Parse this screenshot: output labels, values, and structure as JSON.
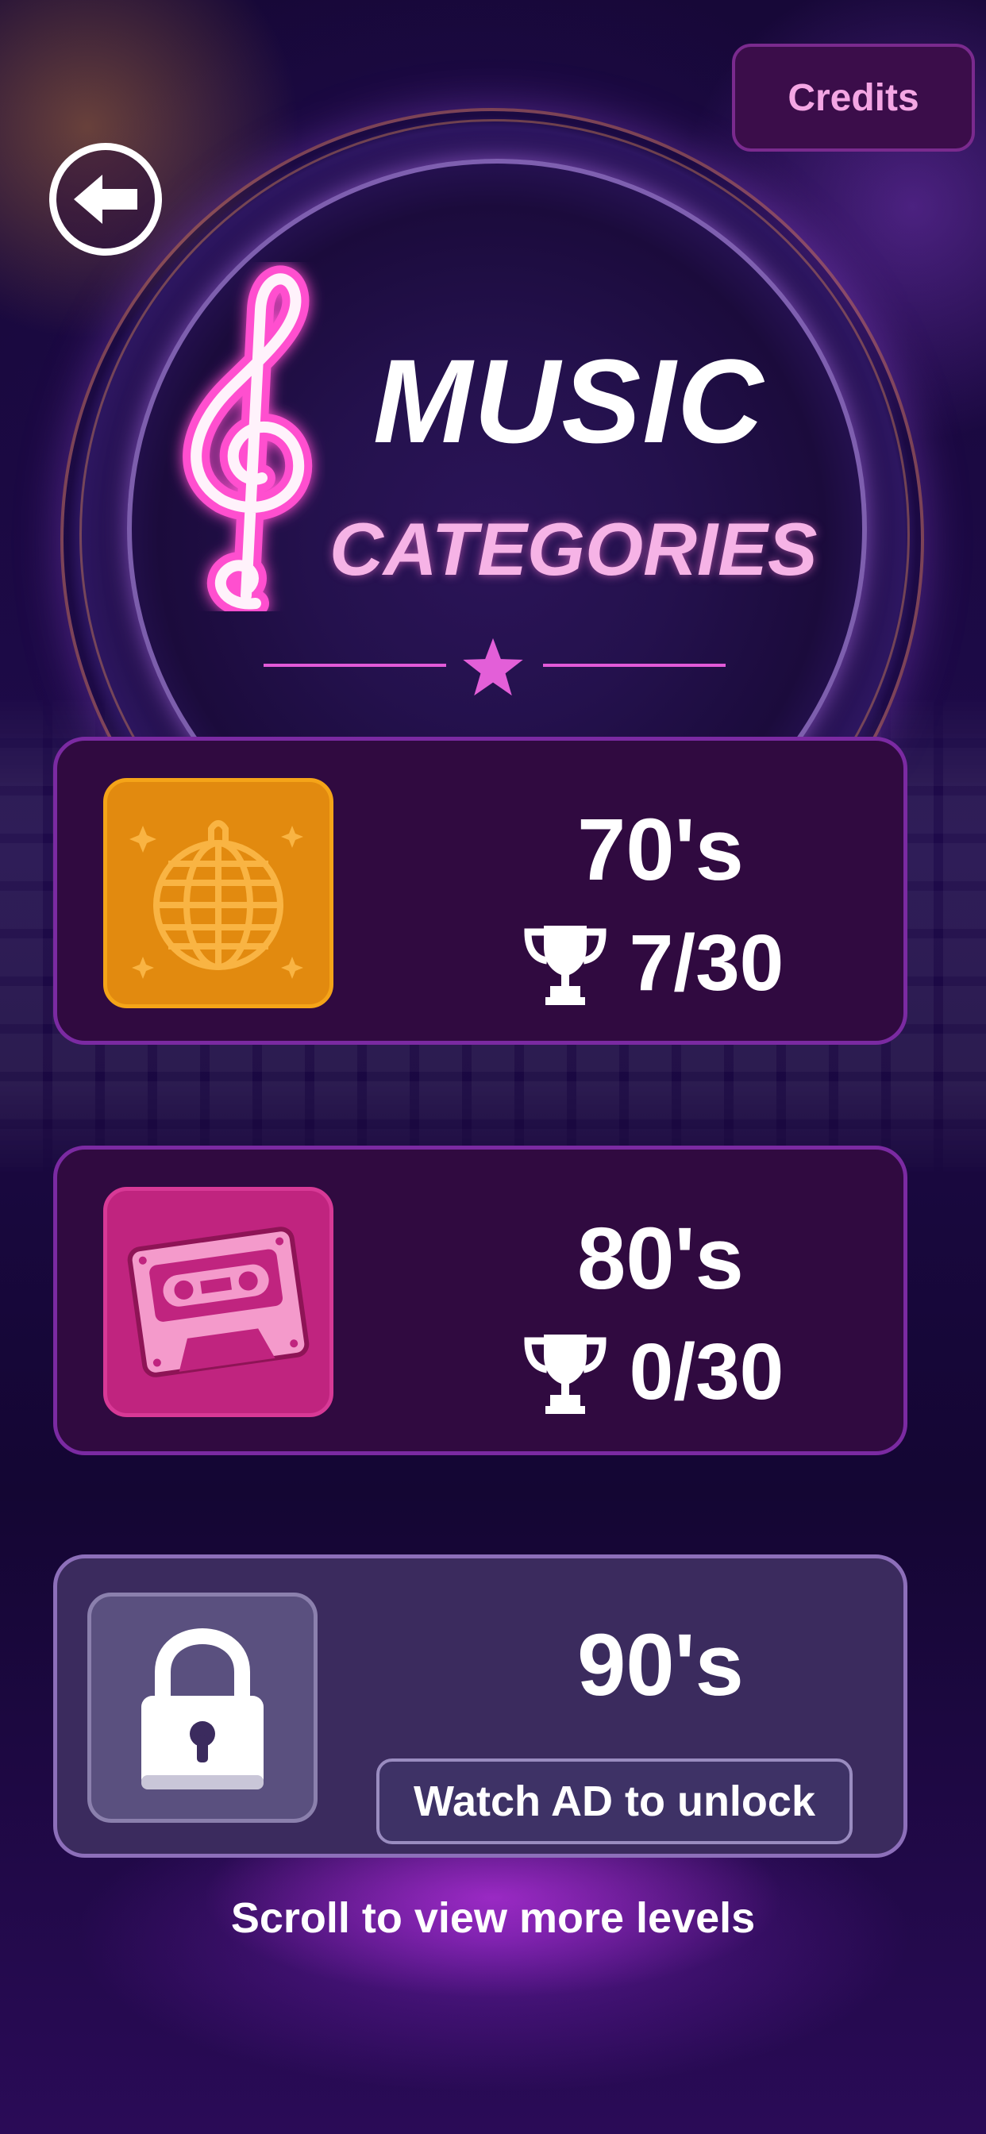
{
  "header": {
    "credits_label": "Credits",
    "back_icon": "back-arrow-icon"
  },
  "title": {
    "line1": "MUSIC",
    "line2": "CATEGORIES",
    "icon": "treble-clef-icon",
    "divider_icon": "star-icon"
  },
  "categories": [
    {
      "name": "70's",
      "progress_text": "7/30",
      "progress": {
        "done": 7,
        "total": 30
      },
      "icon": "disco-ball-icon",
      "tile_color": "#e28a0f",
      "locked": false
    },
    {
      "name": "80's",
      "progress_text": "0/30",
      "progress": {
        "done": 0,
        "total": 30
      },
      "icon": "cassette-tape-icon",
      "tile_color": "#c0247f",
      "locked": false
    },
    {
      "name": "90's",
      "unlock_label": "Watch AD to unlock",
      "icon": "lock-icon",
      "tile_color": "#5a507f",
      "locked": true
    }
  ],
  "footer": {
    "scroll_hint": "Scroll to view more levels"
  },
  "colors": {
    "accent_pink": "#f6b3e6",
    "card_bg": "#300a40",
    "card_border": "#7b2aa2",
    "locked_card_bg": "#3b2b5e"
  }
}
